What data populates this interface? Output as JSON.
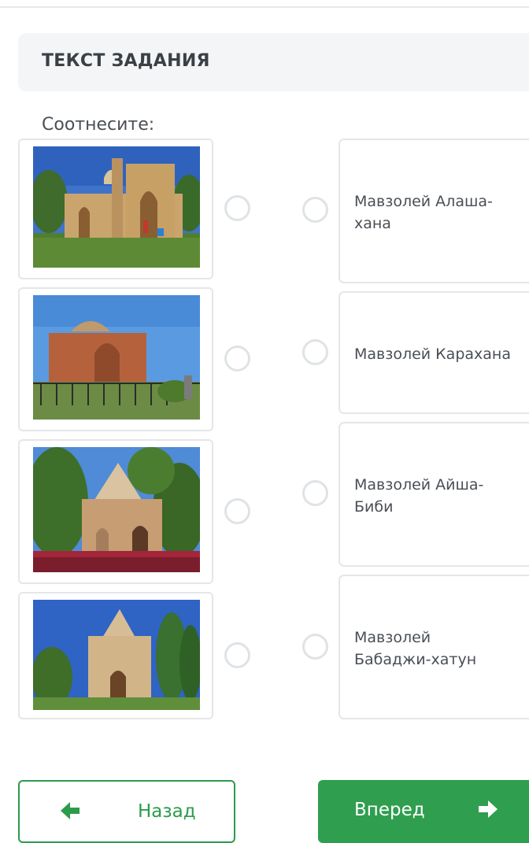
{
  "task": {
    "title": "ТЕКСТ ЗАДАНИЯ",
    "instruction": "Соотнесите:"
  },
  "images": [
    {
      "icon": "mausoleum-photo-1"
    },
    {
      "icon": "mausoleum-photo-2"
    },
    {
      "icon": "mausoleum-photo-3"
    },
    {
      "icon": "mausoleum-photo-4"
    }
  ],
  "options": [
    {
      "label": "Мавзолей Алаша-хана"
    },
    {
      "label": "Мавзолей Карахана"
    },
    {
      "label": "Мавзолей Айша-Биби"
    },
    {
      "label": "Мавзолей Бабаджи-хатун"
    }
  ],
  "nav": {
    "back_label": "Назад",
    "next_label": "Вперед"
  },
  "colors": {
    "accent": "#2f9e4f",
    "radio_border": "#dfe3e6",
    "card_border": "#e4e6e8",
    "header_bg": "#f3f5f6"
  }
}
